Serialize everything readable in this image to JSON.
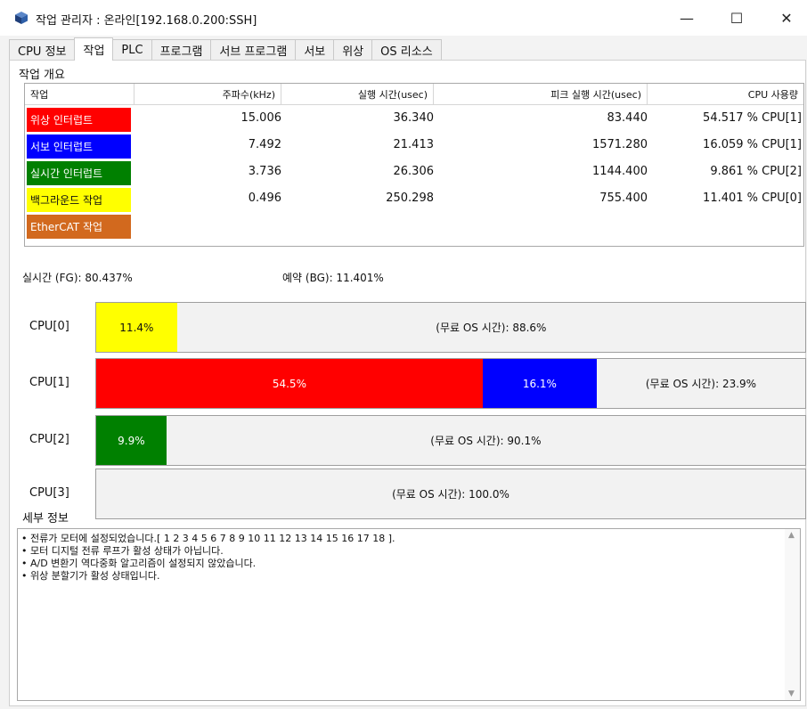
{
  "window": {
    "title": "작업 관리자 : 온라인[192.168.0.200:SSH]",
    "min_glyph": "—",
    "max_glyph": "☐",
    "close_glyph": "✕"
  },
  "tabs": [
    {
      "label": "CPU 정보"
    },
    {
      "label": "작업",
      "active": true
    },
    {
      "label": "PLC"
    },
    {
      "label": "프로그램"
    },
    {
      "label": "서브 프로그램"
    },
    {
      "label": "서보"
    },
    {
      "label": "위상"
    },
    {
      "label": "OS 리소스"
    }
  ],
  "overview": {
    "group_label": "작업 개요",
    "headers": [
      "작업",
      "주파수(kHz)",
      "실행 시간(usec)",
      "피크 실행 시간(usec)",
      "CPU 사용량"
    ],
    "rows": [
      {
        "name": "위상 인터럽트",
        "color": "#ff0000",
        "text_color": "#ffffff",
        "freq": "15.006",
        "exec": "36.340",
        "peak": "83.440",
        "cpu": "54.517 % CPU[1]"
      },
      {
        "name": "서보 인터럽트",
        "color": "#0000ff",
        "text_color": "#ffffff",
        "freq": "7.492",
        "exec": "21.413",
        "peak": "1571.280",
        "cpu": "16.059 % CPU[1]"
      },
      {
        "name": "실시간 인터럽트",
        "color": "#008000",
        "text_color": "#ffffff",
        "freq": "3.736",
        "exec": "26.306",
        "peak": "1144.400",
        "cpu": "9.861 % CPU[2]"
      },
      {
        "name": "백그라운드 작업",
        "color": "#ffff00",
        "text_color": "#111111",
        "freq": "0.496",
        "exec": "250.298",
        "peak": "755.400",
        "cpu": "11.401 % CPU[0]"
      },
      {
        "name": "EtherCAT 작업",
        "color": "#d2691e",
        "text_color": "#ffffff",
        "freq": "",
        "exec": "",
        "peak": "",
        "cpu": ""
      }
    ]
  },
  "summary": {
    "fg": "실시간 (FG): 80.437%",
    "bg": "예약 (BG): 11.401%"
  },
  "cpus": [
    {
      "label": "CPU[0]",
      "segments": [
        {
          "text": "11.4%",
          "pct": 11.4,
          "color": "#ffff00",
          "text_color": "#111111"
        }
      ],
      "free_text": "(무료 OS 시간): 88.6%"
    },
    {
      "label": "CPU[1]",
      "segments": [
        {
          "text": "54.5%",
          "pct": 54.5,
          "color": "#ff0000",
          "text_color": "#ffffff"
        },
        {
          "text": "16.1%",
          "pct": 16.1,
          "color": "#0000ff",
          "text_color": "#ffffff"
        }
      ],
      "free_text": "(무료 OS 시간): 23.9%"
    },
    {
      "label": "CPU[2]",
      "segments": [
        {
          "text": "9.9%",
          "pct": 9.9,
          "color": "#008000",
          "text_color": "#ffffff"
        }
      ],
      "free_text": "(무료 OS 시간): 90.1%"
    },
    {
      "label": "CPU[3]",
      "segments": [],
      "free_text": "(무료 OS 시간): 100.0%"
    }
  ],
  "details": {
    "group_label": "세부 정보",
    "lines": [
      "• 전류가 모터에 설정되었습니다.[ 1  2  3  4  5  6  7  8  9  10  11  12  13  14  15  16  17  18 ].",
      "• 모터 디지털 전류 루프가 활성 상태가 아닙니다.",
      "• A/D 변환기 역다중화 알고리즘이 설정되지 않았습니다.",
      "• 위상 분할기가 활성 상태입니다."
    ],
    "scroll_up_glyph": "▲",
    "scroll_down_glyph": "▼"
  }
}
